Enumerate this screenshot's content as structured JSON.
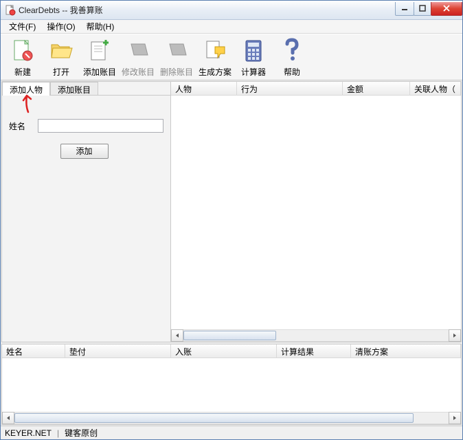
{
  "title": "ClearDebts -- 我善算账",
  "menus": {
    "file": "文件(F)",
    "operate": "操作(O)",
    "help": "帮助(H)"
  },
  "toolbar": {
    "new": "新建",
    "open": "打开",
    "add_entry": "添加账目",
    "edit_entry": "修改账目",
    "del_entry": "删除账目",
    "gen_plan": "生成方案",
    "calculator": "计算器",
    "help": "帮助"
  },
  "tabs": {
    "add_person": "添加人物",
    "add_entry": "添加账目"
  },
  "form": {
    "name_label": "姓名",
    "name_value": "",
    "add_btn": "添加"
  },
  "grid_top": {
    "cols": {
      "person": "人物",
      "action": "行为",
      "amount": "金额",
      "related": "关联人物（"
    }
  },
  "grid_bottom": {
    "cols": {
      "name": "姓名",
      "paid": "垫付",
      "income": "入账",
      "calc_result": "计算结果",
      "plan": "清账方案"
    }
  },
  "status": {
    "site": "KEYER.NET",
    "author": "键客原创"
  },
  "icons": {
    "app": "doc-icon",
    "new": "new-doc-icon",
    "open": "folder-icon",
    "add_entry": "entry-plus-icon",
    "edit_entry": "entry-edit-icon",
    "del_entry": "entry-del-icon",
    "gen_plan": "gen-plan-icon",
    "calculator": "calculator-icon",
    "help": "help-icon"
  }
}
